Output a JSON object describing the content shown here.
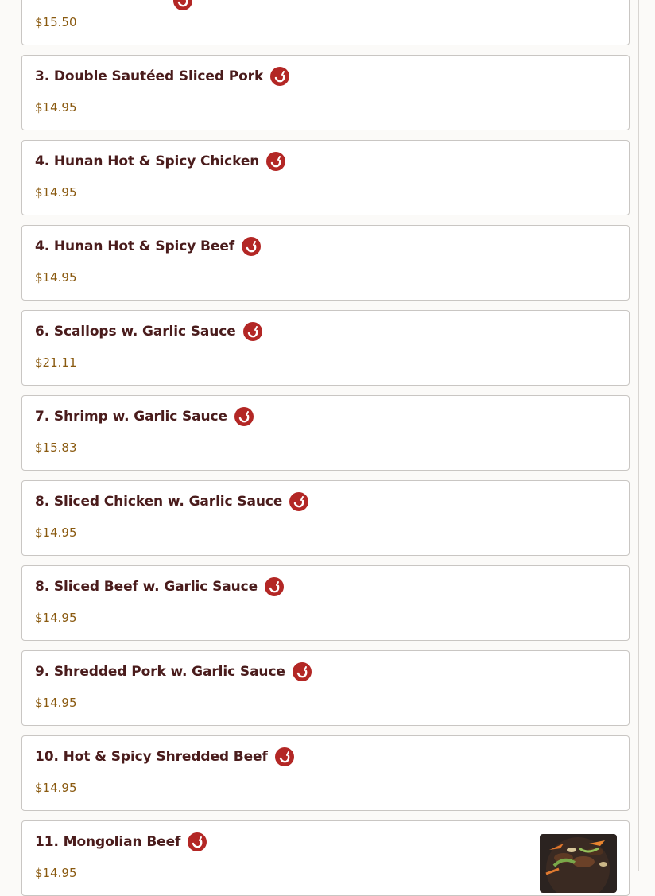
{
  "menu": {
    "partial_item": {
      "price": "$15.50"
    },
    "items": [
      {
        "name": "3. Double Sautéed Sliced Pork",
        "price": "$14.95"
      },
      {
        "name": "4. Hunan Hot & Spicy Chicken",
        "price": "$14.95"
      },
      {
        "name": "4. Hunan Hot & Spicy Beef",
        "price": "$14.95"
      },
      {
        "name": "6. Scallops w. Garlic Sauce",
        "price": "$21.11"
      },
      {
        "name": "7. Shrimp w. Garlic Sauce",
        "price": "$15.83"
      },
      {
        "name": "8. Sliced Chicken w. Garlic Sauce",
        "price": "$14.95"
      },
      {
        "name": "8. Sliced Beef w. Garlic Sauce",
        "price": "$14.95"
      },
      {
        "name": "9. Shredded Pork w. Garlic Sauce",
        "price": "$14.95"
      },
      {
        "name": "10. Hot & Spicy Shredded Beef",
        "price": "$14.95"
      },
      {
        "name": "11. Mongolian Beef",
        "price": "$14.95"
      }
    ]
  },
  "icons": {
    "spicy": "spicy-pepper-icon"
  },
  "colors": {
    "spicy_badge": "#b32725",
    "item_name": "#4a1c1c",
    "price": "#8a5a10"
  }
}
